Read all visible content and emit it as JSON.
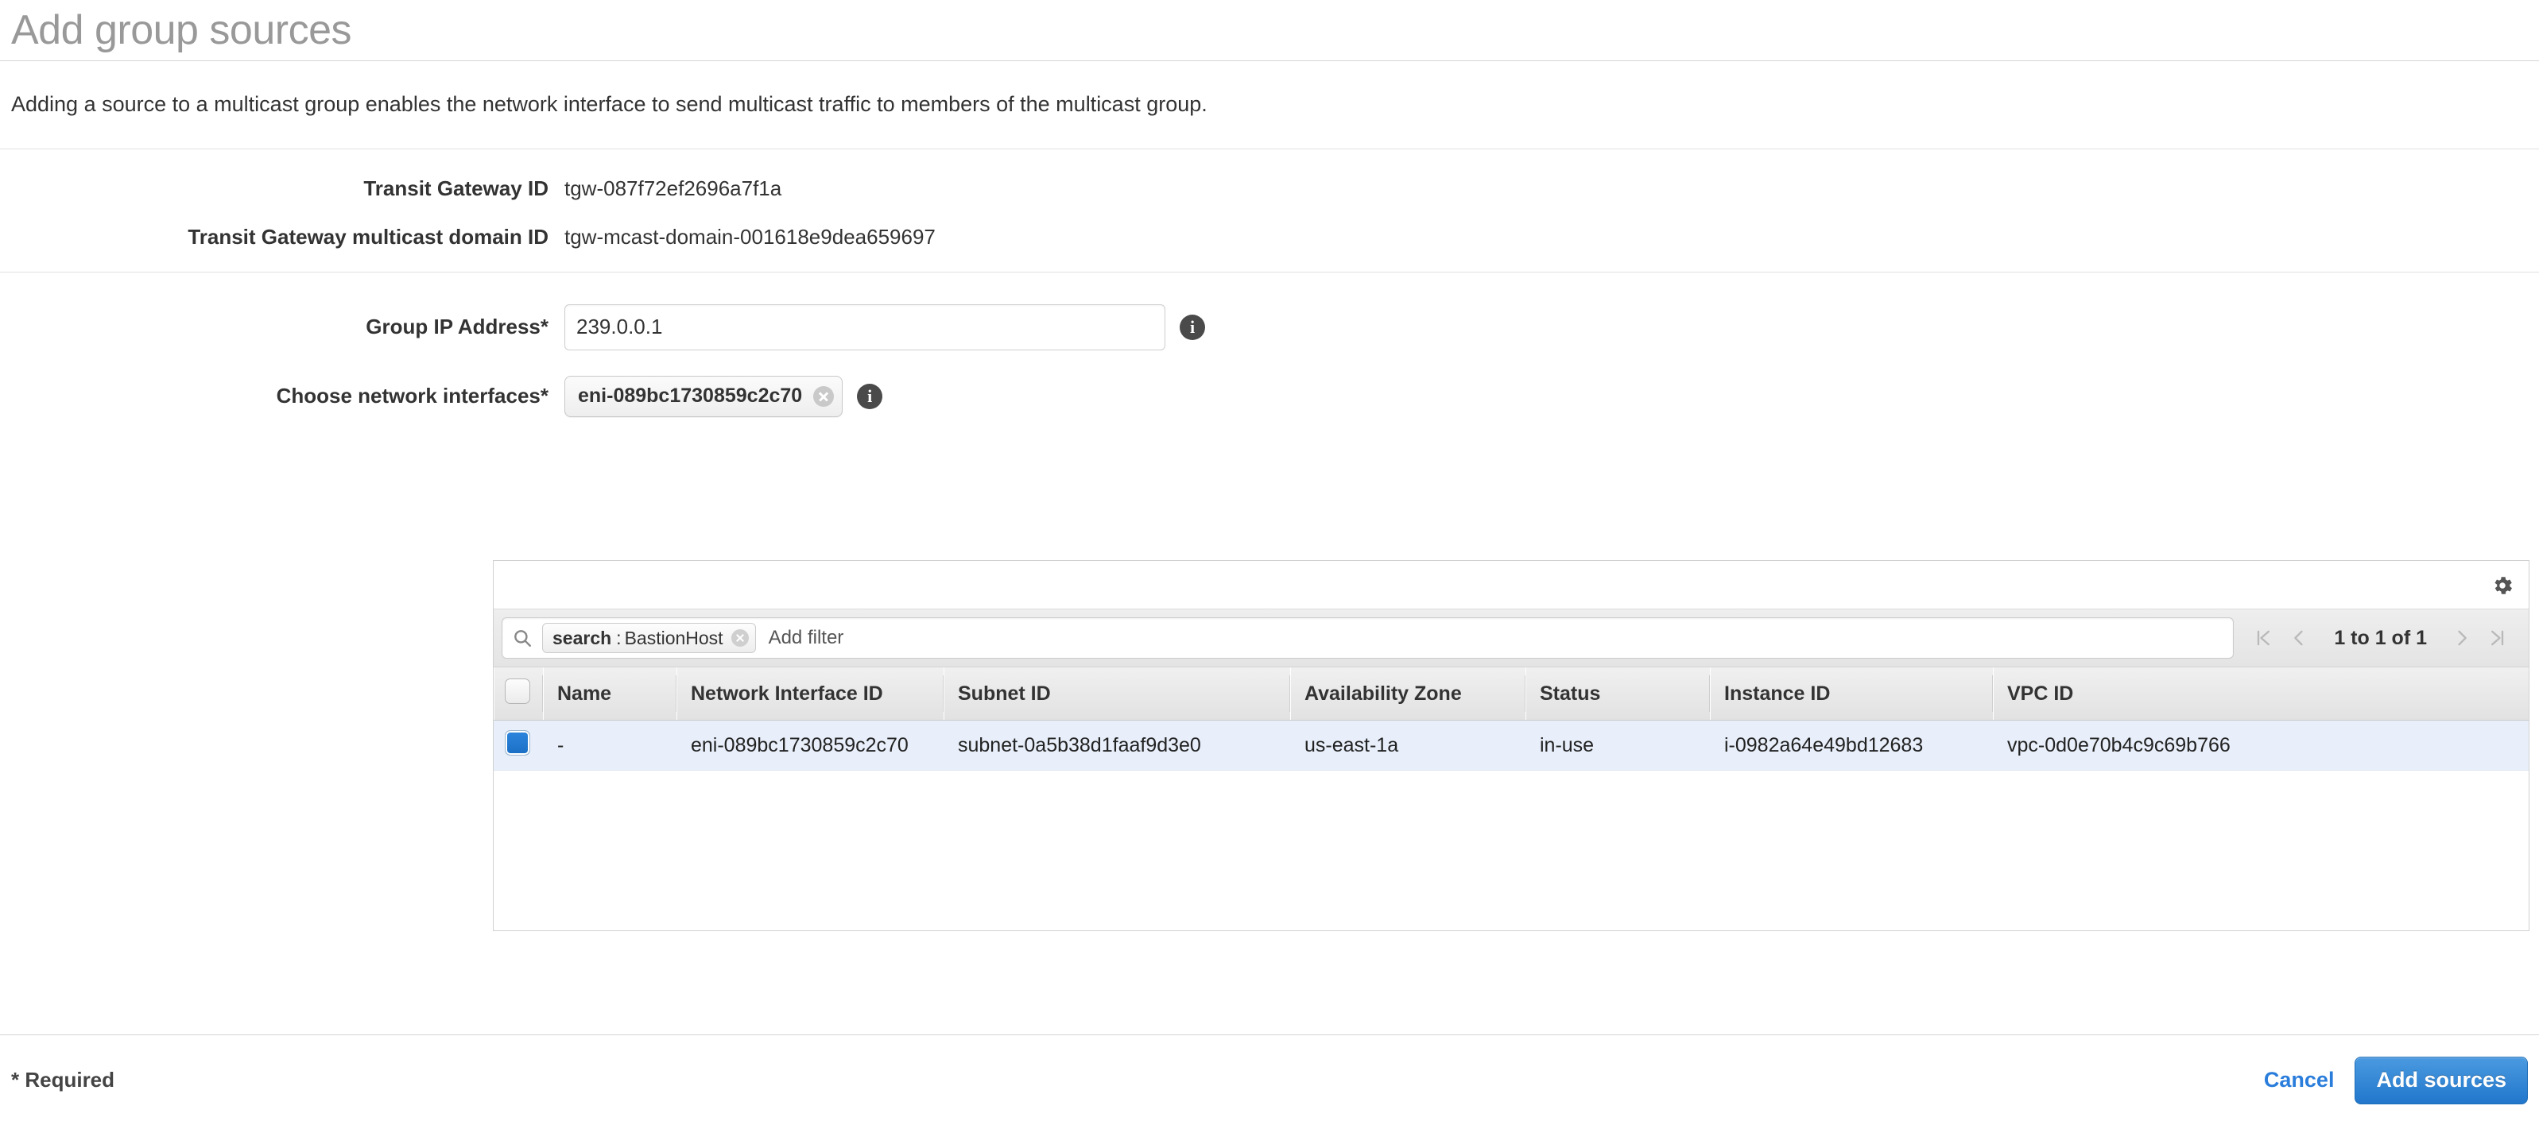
{
  "page": {
    "title": "Add group sources",
    "intro": "Adding a source to a multicast group enables the network interface to send multicast traffic to members of the multicast group."
  },
  "details": [
    {
      "label": "Transit Gateway ID",
      "value": "tgw-087f72ef2696a7f1a"
    },
    {
      "label": "Transit Gateway multicast domain ID",
      "value": "tgw-mcast-domain-001618e9dea659697"
    }
  ],
  "form": {
    "group_ip": {
      "label": "Group IP Address*",
      "value": "239.0.0.1",
      "placeholder": "",
      "info_icon": "info-icon"
    },
    "network_interfaces": {
      "label": "Choose network interfaces*",
      "tokens": [
        "eni-089bc1730859c2c70"
      ],
      "remove_icon": "close-circle-icon",
      "info_icon": "info-icon"
    }
  },
  "panel": {
    "gear_icon": "gear-icon",
    "search": {
      "icon": "search-icon",
      "token_key": "search",
      "token_separator": ":",
      "token_value": "BastionHost",
      "remove_icon": "close-circle-icon",
      "placeholder": "Add filter"
    },
    "pagination": {
      "first_icon": "first-page-icon",
      "prev_icon": "previous-page-icon",
      "label": "1 to 1 of 1",
      "next_icon": "next-page-icon",
      "last_icon": "last-page-icon"
    },
    "table": {
      "columns": [
        "Name",
        "Network Interface ID",
        "Subnet ID",
        "Availability Zone",
        "Status",
        "Instance ID",
        "VPC ID"
      ],
      "rows": [
        {
          "selected": true,
          "name": "-",
          "network_interface_id": "eni-089bc1730859c2c70",
          "subnet_id": "subnet-0a5b38d1faaf9d3e0",
          "availability_zone": "us-east-1a",
          "status": "in-use",
          "instance_id": "i-0982a64e49bd12683",
          "vpc_id": "vpc-0d0e70b4c9c69b766"
        }
      ]
    }
  },
  "footer": {
    "required_note": "* Required",
    "cancel_label": "Cancel",
    "submit_label": "Add sources"
  },
  "colors": {
    "accent_blue": "#2277cc",
    "link_blue": "#2a7ddb",
    "row_selected": "#e8effa",
    "title_gray": "#999999"
  }
}
